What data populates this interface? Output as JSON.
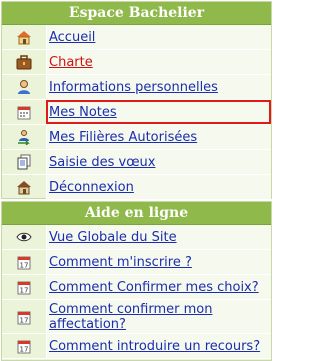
{
  "espace": {
    "title": "Espace Bachelier",
    "items": [
      {
        "label": "Accueil",
        "icon": "home-icon"
      },
      {
        "label": "Charte",
        "icon": "briefcase-icon",
        "color": "#d11010"
      },
      {
        "label": "Informations personnelles",
        "icon": "person-icon"
      },
      {
        "label": "Mes Notes",
        "icon": "calendar-icon",
        "selected": true
      },
      {
        "label": "Mes Filières Autorisées",
        "icon": "user-arrow-icon"
      },
      {
        "label": "Saisie des vœux",
        "icon": "documents-icon"
      },
      {
        "label": "Déconnexion",
        "icon": "house-exit-icon"
      }
    ]
  },
  "aide": {
    "title": "Aide en ligne",
    "items": [
      {
        "label": "Vue Globale du Site",
        "icon": "eye-icon"
      },
      {
        "label": "Comment m'inscrire ?",
        "icon": "calendar-icon"
      },
      {
        "label": "Comment Confirmer mes choix?",
        "icon": "calendar-icon"
      },
      {
        "label": "Comment confirmer mon affectation?",
        "icon": "calendar-icon"
      },
      {
        "label": "Comment introduire un recours?",
        "icon": "calendar-icon"
      }
    ]
  },
  "colors": {
    "header": "#8fb94b",
    "panel": "#ebf3d9",
    "link": "#1b2db0",
    "highlight": "#e11919"
  }
}
